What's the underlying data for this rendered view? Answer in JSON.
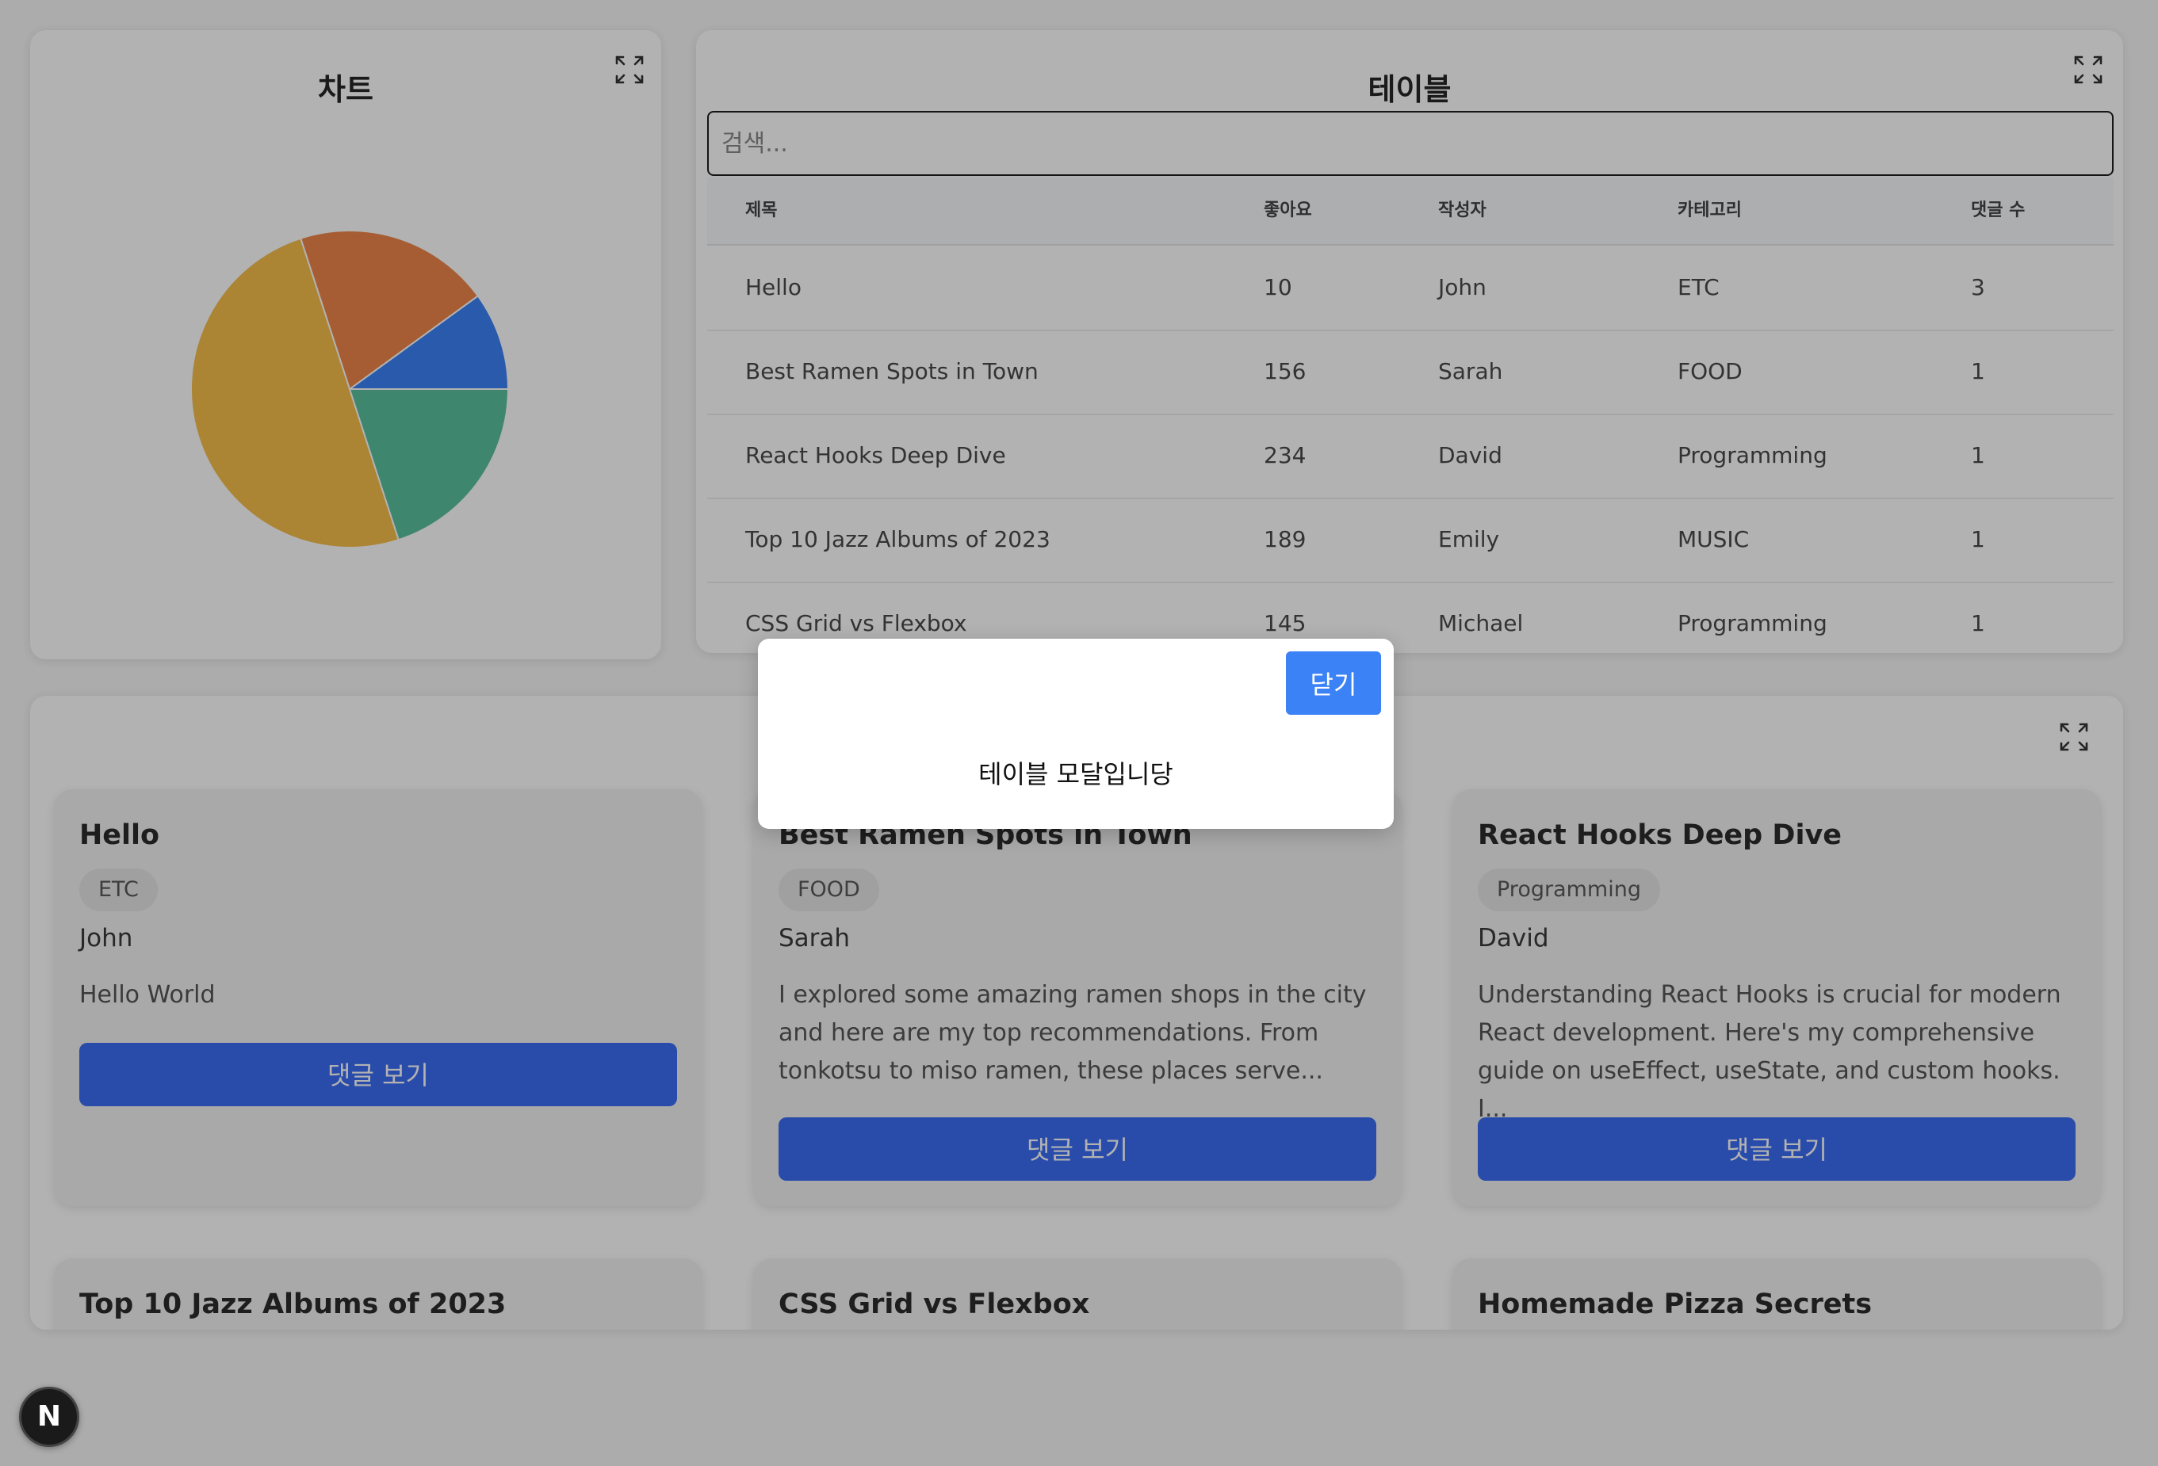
{
  "chart_panel": {
    "title": "차트",
    "expand_icon": "expand-icon"
  },
  "chart_data": {
    "type": "pie",
    "colors": [
      "#3b82f6",
      "#f0864a",
      "#f5bd4b",
      "#5bc1a0"
    ],
    "values": [
      1,
      2,
      5,
      2
    ]
  },
  "table_panel": {
    "title": "테이블",
    "expand_icon": "expand-icon",
    "search_placeholder": "검색...",
    "columns": [
      "제목",
      "좋아요",
      "작성자",
      "카테고리",
      "댓글 수"
    ],
    "rows": [
      [
        "Hello",
        "10",
        "John",
        "ETC",
        "3"
      ],
      [
        "Best Ramen Spots in Town",
        "156",
        "Sarah",
        "FOOD",
        "1"
      ],
      [
        "React Hooks Deep Dive",
        "234",
        "David",
        "Programming",
        "1"
      ],
      [
        "Top 10 Jazz Albums of 2023",
        "189",
        "Emily",
        "MUSIC",
        "1"
      ],
      [
        "CSS Grid vs Flexbox",
        "145",
        "Michael",
        "Programming",
        "1"
      ]
    ]
  },
  "posts_panel": {
    "expand_icon": "expand-icon",
    "comments_button_label": "댓글 보기",
    "cards": [
      {
        "title": "Hello",
        "category": "ETC",
        "author": "John",
        "body": "Hello World"
      },
      {
        "title": "Best Ramen Spots in Town",
        "category": "FOOD",
        "author": "Sarah",
        "body": "I explored some amazing ramen shops in the city and here are my top recommendations. From tonkotsu to miso ramen, these places serve..."
      },
      {
        "title": "React Hooks Deep Dive",
        "category": "Programming",
        "author": "David",
        "body": "Understanding React Hooks is crucial for modern React development. Here's my comprehensive guide on useEffect, useState, and custom hooks. I..."
      },
      {
        "title": "Top 10 Jazz Albums of 2023"
      },
      {
        "title": "CSS Grid vs Flexbox"
      },
      {
        "title": "Homemade Pizza Secrets"
      }
    ]
  },
  "modal": {
    "close_label": "닫기",
    "message": "테이블 모달입니당"
  },
  "next_badge": {
    "label": "N"
  }
}
